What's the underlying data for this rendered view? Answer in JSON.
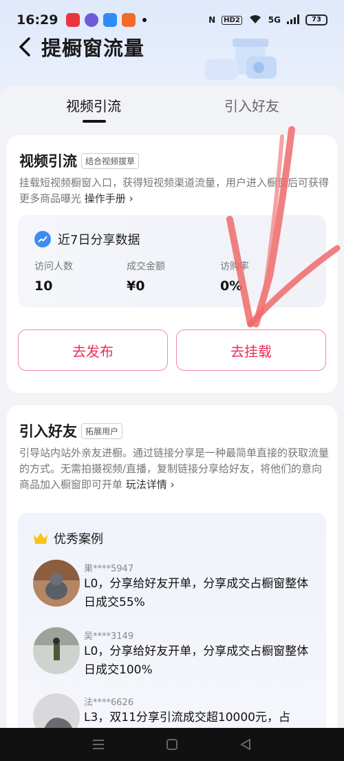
{
  "status": {
    "time": "16:29",
    "network": "5G",
    "hd": "HD2",
    "battery": "73"
  },
  "header": {
    "title": "提橱窗流量"
  },
  "tabs": [
    {
      "label": "视频引流"
    },
    {
      "label": "引入好友"
    }
  ],
  "video_card": {
    "title": "视频引流",
    "tag": "结合视频拔草",
    "desc": "挂载短视频橱窗入口，获得短视频渠道流量，用户进入橱窗后可获得更多商品曝光 ",
    "manual_link": "操作手册",
    "stats": {
      "title": "近7日分享数据",
      "items": [
        {
          "label": "访问人数",
          "value": "10"
        },
        {
          "label": "成交金额",
          "value": "¥0"
        },
        {
          "label": "访购率",
          "value": "0%"
        }
      ]
    },
    "publish_label": "去发布",
    "mount_label": "去挂载"
  },
  "friend_card": {
    "title": "引入好友",
    "tag": "拓展用户",
    "desc": "引导站内站外亲友进橱。通过链接分享是一种最简单直接的获取流量的方式。无需拍摄视频/直播，复制链接分享给好友，将他们的意向商品加入橱窗即可开单 ",
    "detail_link": "玩法详情",
    "cases_title": "优秀案例",
    "cases": [
      {
        "user": "果****5947",
        "text": "L0，分享给好友开单，分享成交占橱窗整体日成交55%"
      },
      {
        "user": "吴****3149",
        "text": "L0，分享给好友开单，分享成交占橱窗整体日成交100%"
      },
      {
        "user": "法****6626",
        "text": "L3，双11分享引流成交超10000元，占"
      }
    ]
  },
  "colors": {
    "accent": "#ee2d5a",
    "trend": "#3b8df0",
    "crown": "#f5c518"
  }
}
